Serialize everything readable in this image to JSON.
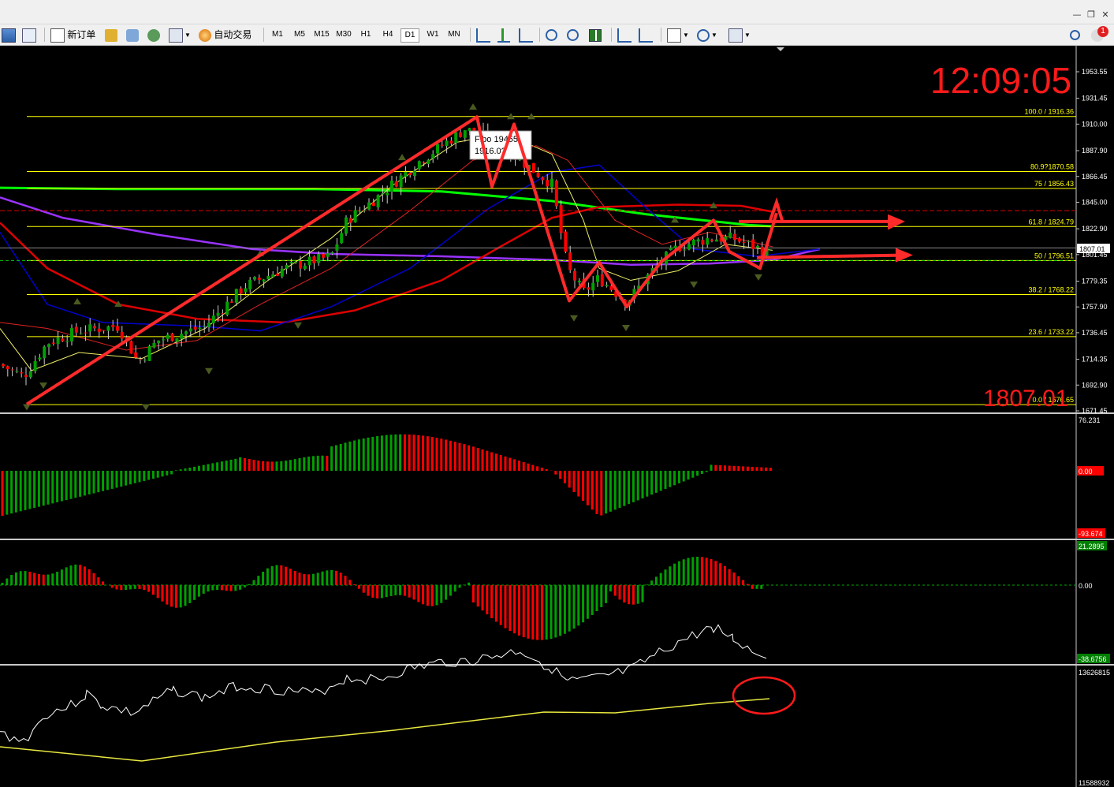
{
  "window": {
    "controls": [
      "minimize-icon",
      "restore-icon",
      "close-icon"
    ]
  },
  "toolbar": {
    "new_order_label": "新订单",
    "auto_trade_label": "自动交易",
    "timeframes": [
      "M1",
      "M5",
      "M15",
      "M30",
      "H1",
      "H4",
      "D1",
      "W1",
      "MN"
    ],
    "selected_timeframe": "D1",
    "notification_count": "1"
  },
  "price_chart": {
    "clock": "12:09:05",
    "price_watermark": "1807.01",
    "current_price_tag": "1807.01",
    "price_axis_labels": [
      "1953.55",
      "1931.45",
      "1910.00",
      "1887.90",
      "1866.45",
      "1845.00",
      "1822.90",
      "1801.45",
      "1779.35",
      "1757.90",
      "1736.45",
      "1714.35",
      "1692.90",
      "1671.45"
    ],
    "fibonacci_levels": [
      {
        "label": "100.0  /  1916.36",
        "price": 1916.36
      },
      {
        "label": "80.9?1870.58",
        "price": 1870.58
      },
      {
        "label": "75  /  1856.43",
        "price": 1856.43
      },
      {
        "label": "61.8  /  1824.79",
        "price": 1824.79
      },
      {
        "label": "50  /  1796.51",
        "price": 1796.51
      },
      {
        "label": "38.2  /  1768.22",
        "price": 1768.22
      },
      {
        "label": "23.6  /  1733.22",
        "price": 1733.22
      },
      {
        "label": "0.0  /  1676.65",
        "price": 1676.65
      }
    ],
    "tooltip": {
      "line1": "Fibo 19455",
      "line2": "1916.0?"
    }
  },
  "macd_panel": {
    "max_label": "76.231",
    "zero_label": "0.00",
    "min_label": "-93.674"
  },
  "osc_panel": {
    "max_label": "21.2895",
    "zero_label": "0.00",
    "min_label": "-38.6756"
  },
  "volume_panel": {
    "max_label": "13626815",
    "min_label": "11588932"
  },
  "colors": {
    "bull": "#00a000",
    "bear": "#ff0000",
    "fibo": "#ffff00",
    "ma_green": "#00ff00",
    "ma_purple": "#9933ff",
    "ma_red": "#dd0000",
    "ma_blue": "#0000cc",
    "arrow": "#ff2a2a"
  }
}
